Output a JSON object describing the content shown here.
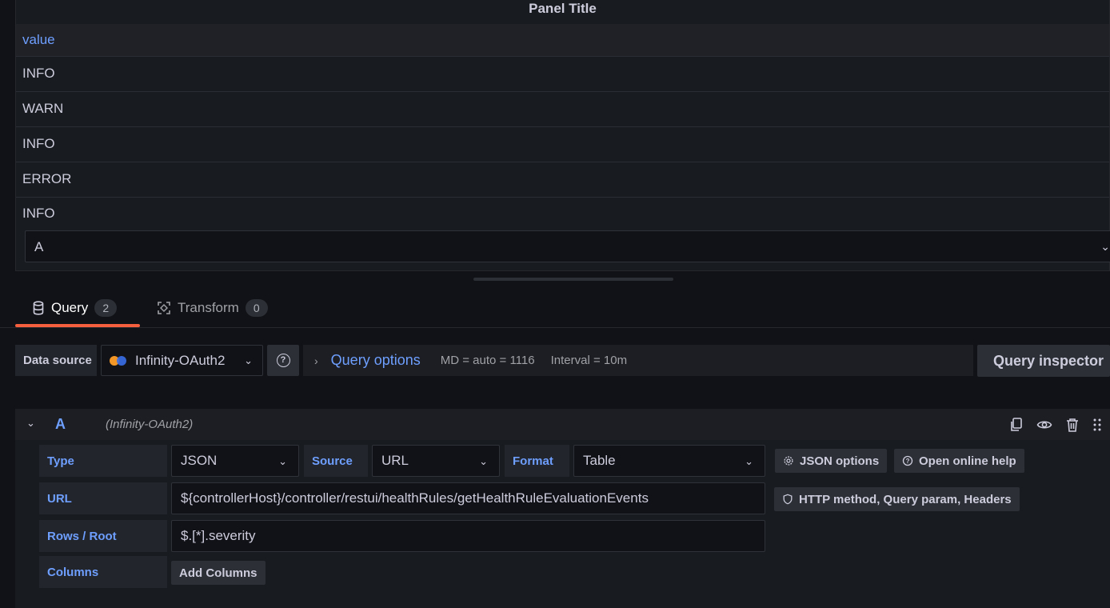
{
  "panel": {
    "title": "Panel Title",
    "column_header": "value",
    "rows": [
      "INFO",
      "WARN",
      "INFO",
      "ERROR",
      "INFO"
    ],
    "frame_select_value": "A"
  },
  "tabs": [
    {
      "label": "Query",
      "count": "2",
      "icon": "database-icon",
      "active": true
    },
    {
      "label": "Transform",
      "count": "0",
      "icon": "transform-icon",
      "active": false
    }
  ],
  "datasource": {
    "label": "Data source",
    "selected": "Infinity-OAuth2",
    "query_options_label": "Query options",
    "md": "MD = auto = 1116",
    "interval": "Interval = 10m",
    "inspector_label": "Query inspector"
  },
  "query": {
    "ref_id": "A",
    "ds_name": "(Infinity-OAuth2)",
    "type_label": "Type",
    "type_value": "JSON",
    "source_label": "Source",
    "source_value": "URL",
    "format_label": "Format",
    "format_value": "Table",
    "json_options_label": "JSON options",
    "help_label": "Open online help",
    "url_label": "URL",
    "url_value": "${controllerHost}/controller/restui/healthRules/getHealthRuleEvaluationEvents",
    "http_label": "HTTP method, Query param, Headers",
    "rows_root_label": "Rows / Root",
    "rows_root_value": "$.[*].severity",
    "columns_label": "Columns",
    "add_columns_label": "Add Columns"
  },
  "colors": {
    "accent_blue": "#6e9fff",
    "tab_underline": "#f55f3e",
    "background": "#111217"
  }
}
